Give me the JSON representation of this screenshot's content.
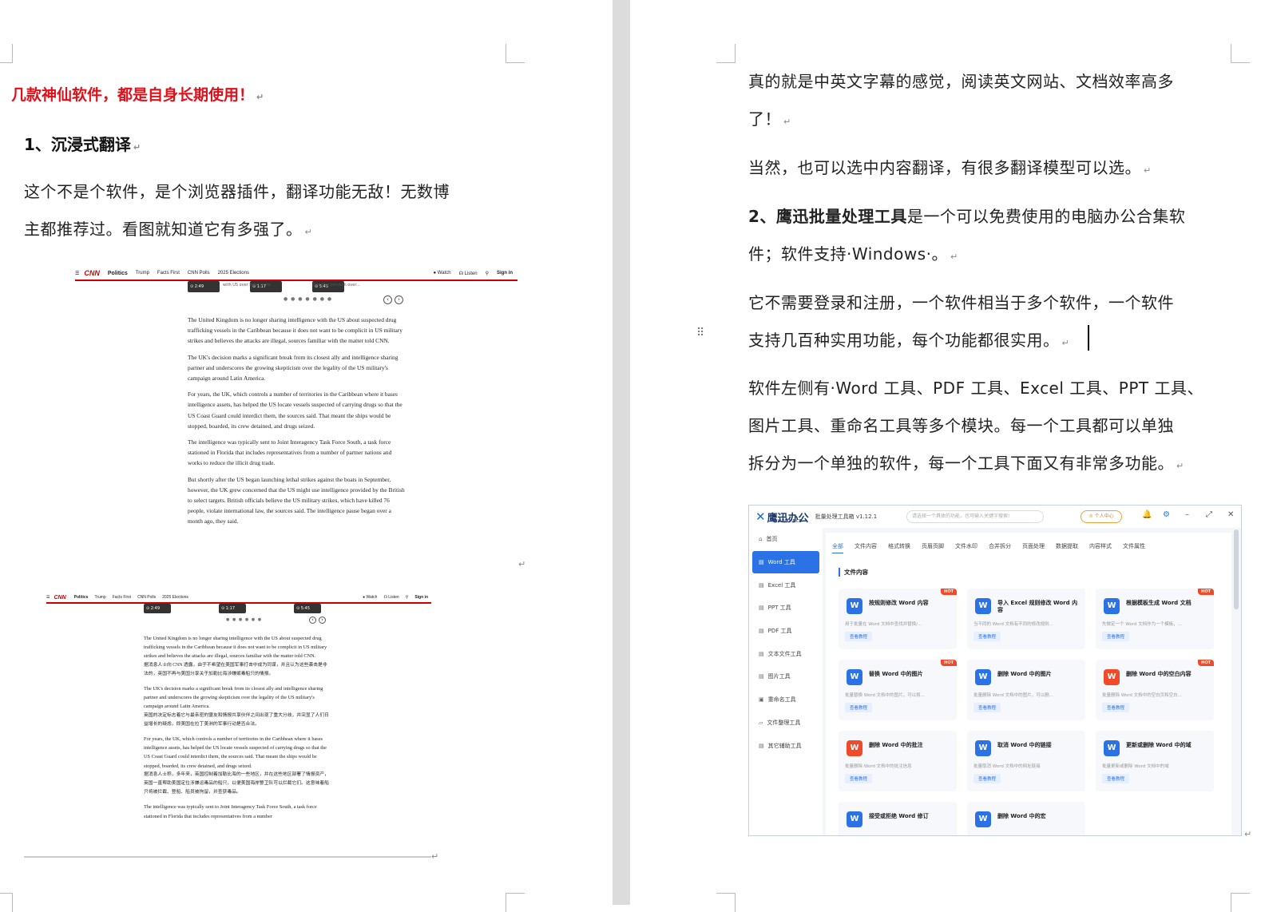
{
  "left_page": {
    "red_title": "几款神仙软件，都是自身长期使用！",
    "heading1": "1、沉浸式翻译",
    "para1_line1": "这个不是个软件，是个浏览器插件，翻译功能无敌！无数博",
    "para1_line2": "主都推荐过。看图就知道它有多强了。",
    "para_mark": "↵",
    "screenshot1": {
      "nav_logo": "CNN",
      "nav_items": [
        "Politics",
        "Trump",
        "Facts First",
        "CNN Polls",
        "2025 Elections"
      ],
      "nav_right": [
        "● Watch",
        "☊ Listen",
        "⚲",
        "Sign in"
      ],
      "thumb_labels": [
        "⊙ 2:49",
        "⊙ 1:17",
        "⊙ 5:45"
      ],
      "thumb_captions": [
        "with US over boat strike",
        "Speaker Johnson over..."
      ],
      "paragraphs": [
        "The United Kingdom is no longer sharing intelligence with the US about suspected drug trafficking vessels in the Caribbean because it does not want to be complicit in US military strikes and believes the attacks are illegal, sources familiar with the matter told CNN.",
        "The UK's decision marks a significant break from its closest ally and intelligence sharing partner and underscores the growing skepticism over the legality of the US military's campaign around Latin America.",
        "For years, the UK, which controls a number of territories in the Caribbean where it bases intelligence assets, has helped the US locate vessels suspected of carrying drugs so that the US Coast Guard could interdict them, the sources said. That meant the ships would be stopped, boarded, its crew detained, and drugs seized.",
        "The intelligence was typically sent to Joint Interagency Task Force South, a task force stationed in Florida that includes representatives from a number of partner nations and works to reduce the illicit drug trade.",
        "But shortly after the US began launching lethal strikes against the boats in September, however, the UK grew concerned that the US might use intelligence provided by the British to select targets. British officials believe the US military strikes, which have killed 76 people, violate international law, the sources said. The intelligence pause began over a month ago, they said."
      ]
    },
    "screenshot2": {
      "paragraphs": [
        "The United Kingdom is no longer sharing intelligence with the US about suspected drug trafficking vessels in the Caribbean because it does not want to be complicit in US military strikes and believes the attacks are illegal, sources familiar with the matter told CNN.",
        "据消息人士向 CNN 透露，由于不希望在美国军事打击中成为同谋，并且认为这些袭击是非法的，英国不再与美国分享关于加勒比海涉嫌贩毒船只的情报。",
        "The UK's decision marks a significant break from its closest ally and intelligence sharing partner and underscores the growing skepticism over the legality of the US military's campaign around Latin America.",
        "英国的决定标志着它与最亲密的盟友和情报共享伙伴之间出现了重大分歧，并突显了人们日益增长的疑虑，即美国在拉丁美洲的军事行动是否合法。",
        "For years, the UK, which controls a number of territories in the Caribbean where it bases intelligence assets, has helped the US locate vessels suspected of carrying drugs so that the US Coast Guard could interdict them, the sources said. That meant the ships would be stopped, boarded, its crew detained, and drugs seized.",
        "据消息人士称，多年来，英国控制着加勒比海的一些地区，并在这些地区部署了情报资产，英国一直帮助美国定位涉嫌运毒品的船只，以便美国海岸警卫队可以拦截它们。这意味着船只将被拦截、登船、船员被拘留，并查获毒品。",
        "The intelligence was typically sent to Joint Interagency Task Force South, a task force stationed in Florida that includes representatives from a number"
      ]
    }
  },
  "right_page": {
    "line1": "真的就是中英文字幕的感觉，阅读英文网站、文档效率高多",
    "line2": "了！",
    "para2": "当然，也可以选中内容翻译，有很多翻译模型可以选。",
    "heading2_bold": "2、鹰迅批量处理工具",
    "heading2_rest": "是一个可以免费使用的电脑办公合集软",
    "para3_line2": "件；软件支持·Windows·。",
    "para4_line1": "它不需要登录和注册，一个软件相当于多个软件，一个软件",
    "para4_line2": "支持几百种实用功能，每个功能都很实用。",
    "para5_line1": "软件左侧有·Word 工具、PDF 工具、Excel 工具、PPT 工具、",
    "para5_line2": "图片工具、重命名工具等多个模块。每一个工具都可以单独",
    "para5_line3": "拆分为一个单独的软件，每一个工具下面又有非常多功能。"
  },
  "app": {
    "logo_text": "鹰迅办公",
    "logo_sub": "INXUN OFFICE",
    "app_name": "批量处理工具箱 v1.12.1",
    "search_placeholder": "请选择一个具体的功能，也可输入关键字搜索!",
    "user_center": "♔ 个人中心",
    "accent": "#2b72e6",
    "sidebar": [
      {
        "icon": "⌂",
        "label": "首页"
      },
      {
        "icon": "▤",
        "label": "Word 工具"
      },
      {
        "icon": "▤",
        "label": "Excel 工具"
      },
      {
        "icon": "▤",
        "label": "PPT 工具"
      },
      {
        "icon": "▤",
        "label": "PDF 工具"
      },
      {
        "icon": "▤",
        "label": "文本文件工具"
      },
      {
        "icon": "▤",
        "label": "图片工具"
      },
      {
        "icon": "▣",
        "label": "重命名工具"
      },
      {
        "icon": "▱",
        "label": "文件整理工具"
      },
      {
        "icon": "▤",
        "label": "其它辅助工具"
      }
    ],
    "tabs": [
      "全部",
      "文件内容",
      "格式转换",
      "页眉页脚",
      "文件水印",
      "合并拆分",
      "页面处理",
      "数据提取",
      "内容样式",
      "文件属性"
    ],
    "section_title": "文件内容",
    "button_label": "查看教程",
    "hot_label": "HOT",
    "cards": [
      {
        "title": "按规则修改 Word 内容",
        "desc": "用于批量在 Word 文档中查找并替换/...",
        "hot": true
      },
      {
        "title": "导入 Excel 规则修改 Word 内容",
        "desc": "当不同的 Word 文档有不同的修改规则...",
        "hot": false
      },
      {
        "title": "根据模板生成 Word 文档",
        "desc": "先做定一个 Word 文档作为一个模板，...",
        "hot": true
      },
      {
        "title": "替换 Word 中的图片",
        "desc": "批量替换 Word 文档中的图片，可以将...",
        "hot": true
      },
      {
        "title": "删除 Word 中的图片",
        "desc": "批量删除 Word 文档中的图片，可以删...",
        "hot": false
      },
      {
        "title": "删除 Word 中的空白内容",
        "desc": "批量删除 Word 文档中的空白页和空白...",
        "hot": true
      },
      {
        "title": "删除 Word 中的批注",
        "desc": "批量删除 Word 文档中的批注信息",
        "hot": false
      },
      {
        "title": "取消 Word 中的链接",
        "desc": "批量取消 Word 文档中的网址链接",
        "hot": false
      },
      {
        "title": "更新或删除 Word 中的域",
        "desc": "批量更新或删除 Word 文档中的域",
        "hot": false
      },
      {
        "title": "接受或拒绝 Word 修订",
        "desc": "",
        "hot": false
      },
      {
        "title": "删除 Word 中的宏",
        "desc": "",
        "hot": false
      }
    ]
  }
}
